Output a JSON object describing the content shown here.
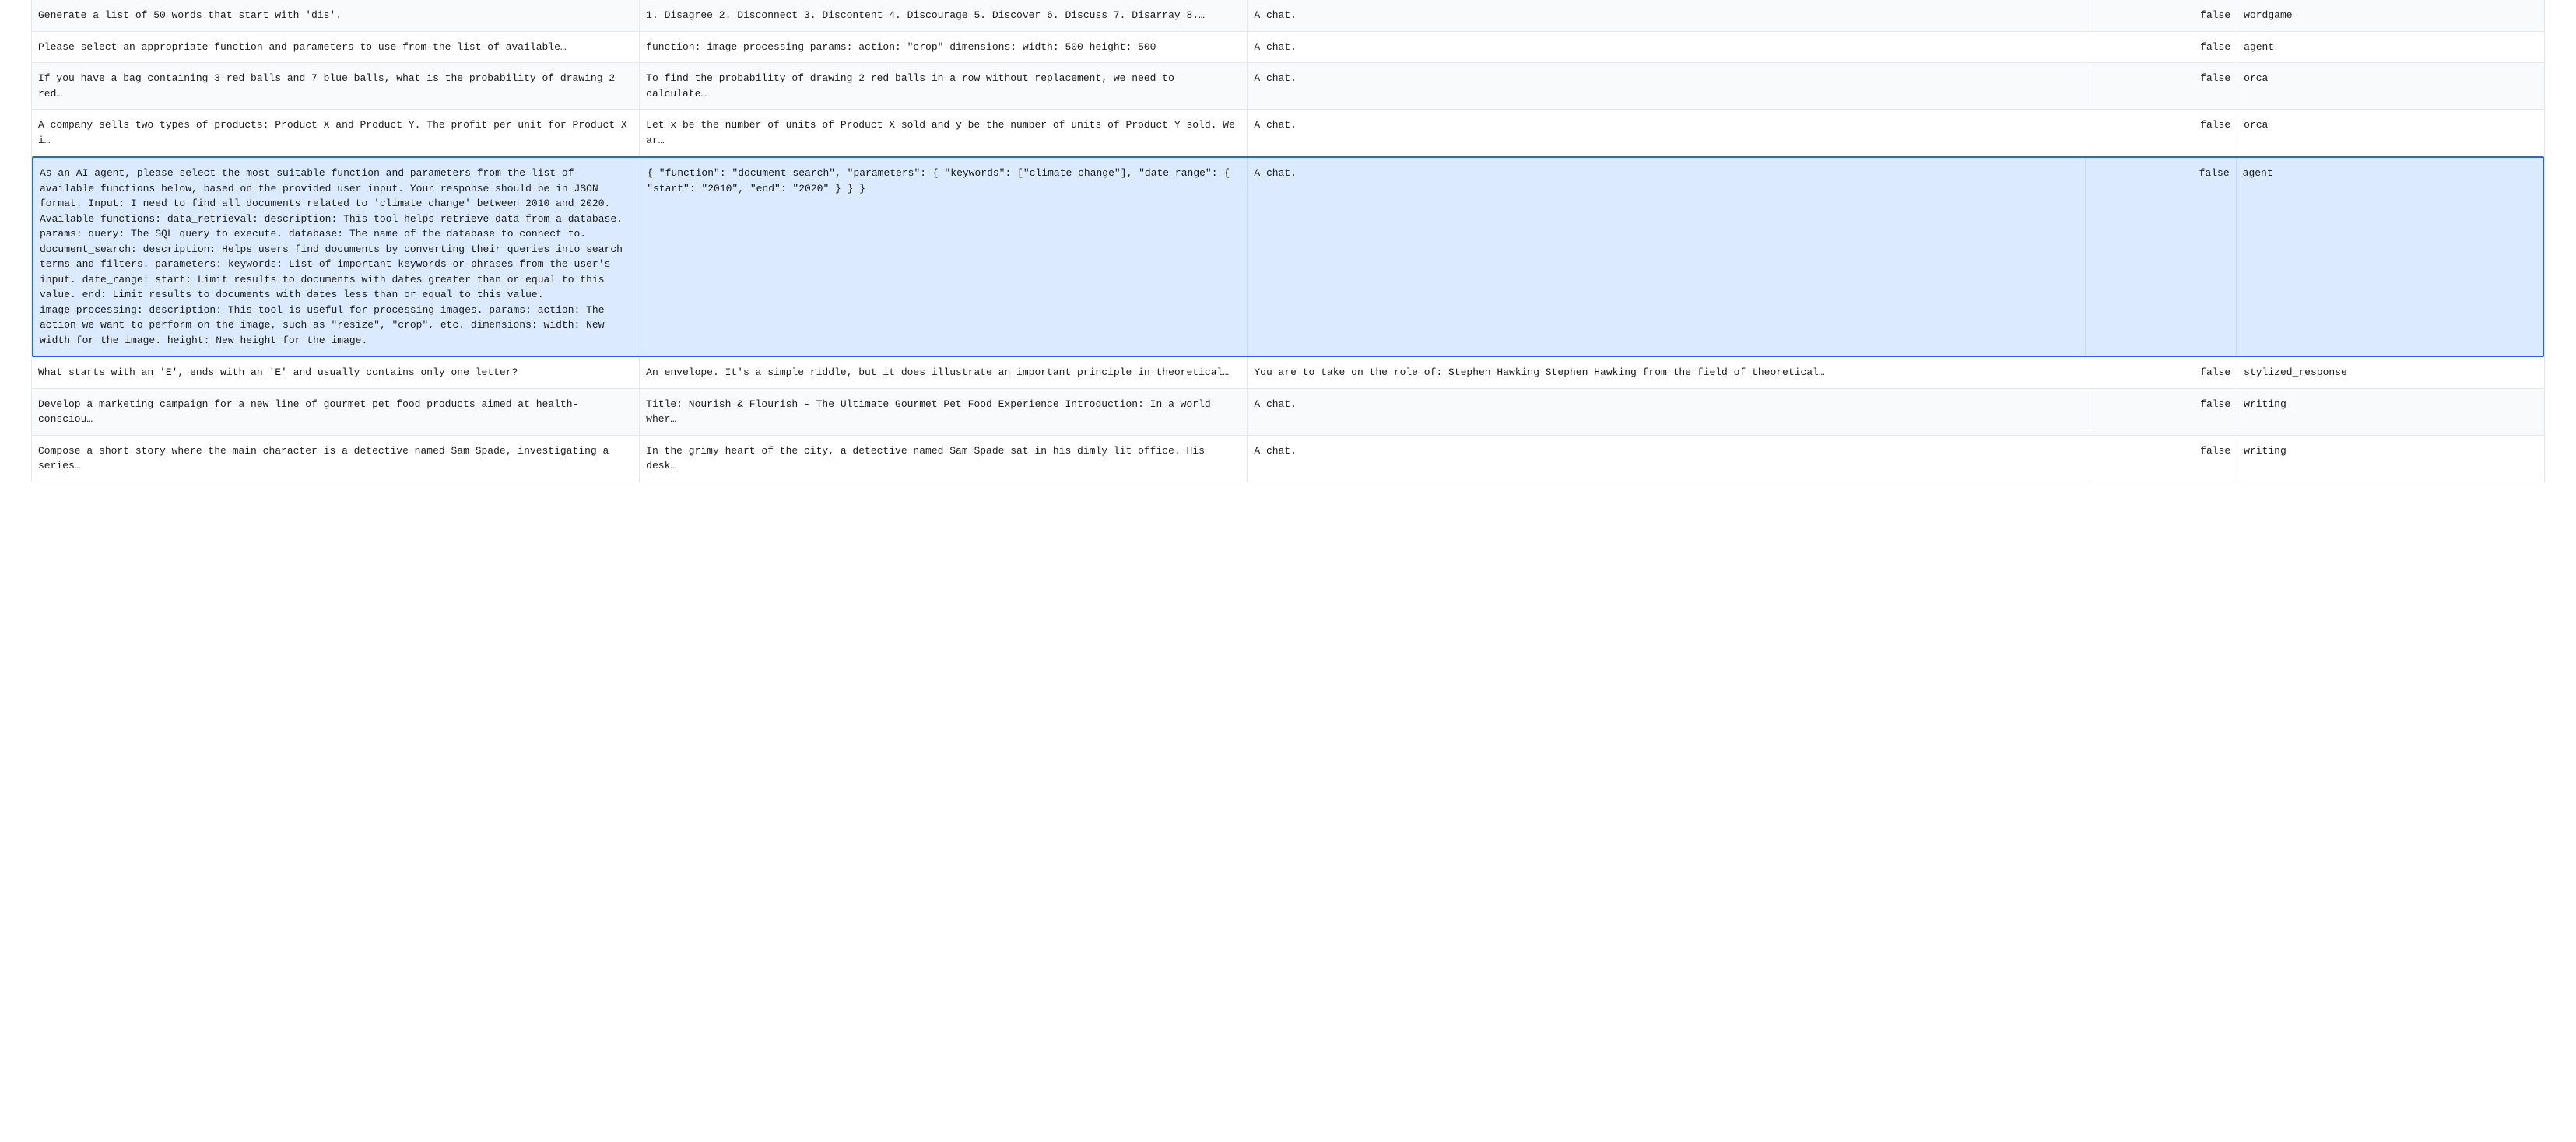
{
  "rows": [
    {
      "instruction": "Generate a list of 50 words that start with 'dis'.",
      "response": "1. Disagree 2. Disconnect 3. Discontent 4. Discourage 5. Discover 6. Discuss 7. Disarray 8.…",
      "system": "A chat.",
      "skip": "false",
      "category": "wordgame",
      "alt": true,
      "selected": false,
      "expanded": false
    },
    {
      "instruction": "Please select an appropriate function and parameters to use from the list of available…",
      "response": "function: image_processing params: action: \"crop\" dimensions: width: 500 height: 500",
      "system": "A chat.",
      "skip": "false",
      "category": "agent",
      "alt": false,
      "selected": false,
      "expanded": false
    },
    {
      "instruction": "If you have a bag containing 3 red balls and 7 blue balls, what is the probability of drawing 2 red…",
      "response": "To find the probability of drawing 2 red balls in a row without replacement, we need to calculate…",
      "system": "A chat.",
      "skip": "false",
      "category": "orca",
      "alt": true,
      "selected": false,
      "expanded": false
    },
    {
      "instruction": "A company sells two types of products: Product X and Product Y. The profit per unit for Product X i…",
      "response": "Let x be the number of units of Product X sold and y be the number of units of Product Y sold. We ar…",
      "system": "A chat.",
      "skip": "false",
      "category": "orca",
      "alt": false,
      "selected": false,
      "expanded": false
    },
    {
      "instruction": "As an AI agent, please select the most suitable function and parameters from the list of available functions below, based on the provided user input. Your response should be in JSON format. Input: I need to find all documents related to 'climate change' between 2010 and 2020. Available functions: data_retrieval: description: This tool helps retrieve data from a database. params: query: The SQL query to execute. database: The name of the database to connect to. document_search: description: Helps users find documents by converting their queries into search terms and filters. parameters: keywords: List of important keywords or phrases from the user's input. date_range: start: Limit results to documents with dates greater than or equal to this value. end: Limit results to documents with dates less than or equal to this value. image_processing: description: This tool is useful for processing images. params: action: The action we want to perform on the image, such as \"resize\", \"crop\", etc. dimensions: width: New width for the image. height: New height for the image.",
      "response": "{ \"function\": \"document_search\", \"parameters\": { \"keywords\": [\"climate change\"], \"date_range\": { \"start\": \"2010\", \"end\": \"2020\" } } }",
      "system": "A chat.",
      "skip": "false",
      "category": "agent",
      "alt": true,
      "selected": true,
      "expanded": true
    },
    {
      "instruction": "What starts with an 'E', ends with an 'E' and usually contains only one letter?",
      "response": "An envelope. It's a simple riddle, but it does illustrate an important principle in theoretical…",
      "system": "You are to take on the role of: Stephen Hawking Stephen Hawking from the field of theoretical…",
      "skip": "false",
      "category": "stylized_response",
      "alt": false,
      "selected": false,
      "expanded": false
    },
    {
      "instruction": "Develop a marketing campaign for a new line of gourmet pet food products aimed at health-consciou…",
      "response": "Title: Nourish & Flourish - The Ultimate Gourmet Pet Food Experience Introduction: In a world wher…",
      "system": "A chat.",
      "skip": "false",
      "category": "writing",
      "alt": true,
      "selected": false,
      "expanded": false
    },
    {
      "instruction": "Compose a short story where the main character is a detective named Sam Spade, investigating a series…",
      "response": "In the grimy heart of the city, a detective named Sam Spade sat in his dimly lit office. His desk…",
      "system": "A chat.",
      "skip": "false",
      "category": "writing",
      "alt": false,
      "selected": false,
      "expanded": false
    }
  ]
}
